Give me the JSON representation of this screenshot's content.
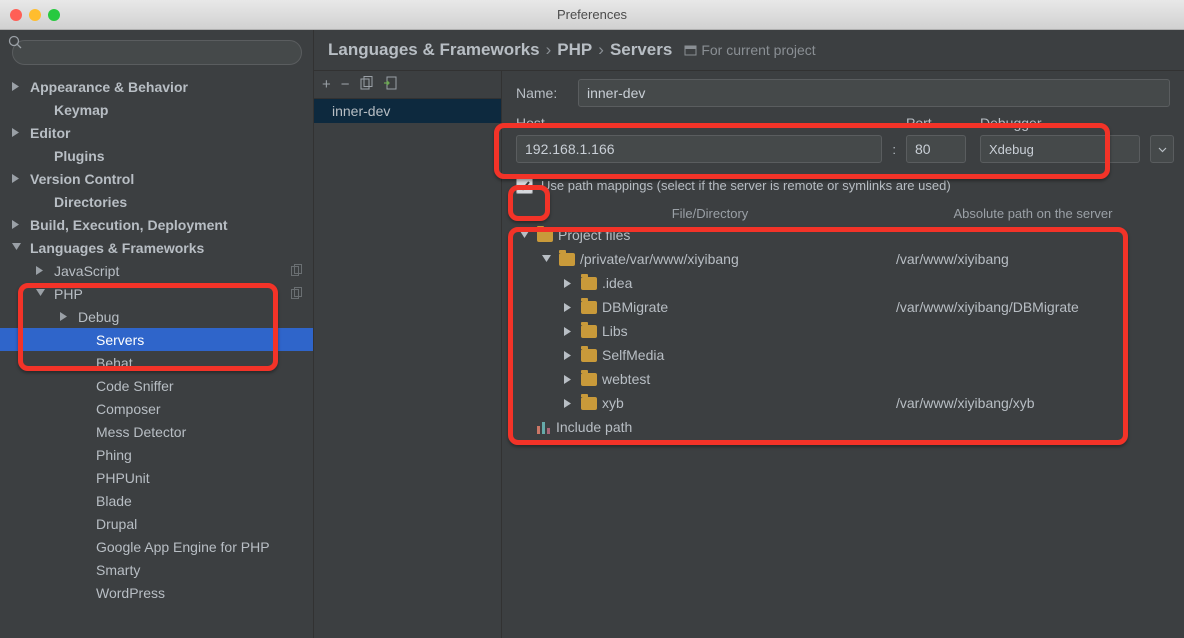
{
  "window": {
    "title": "Preferences"
  },
  "sidebar": {
    "search_placeholder": "",
    "items": [
      {
        "label": "Appearance & Behavior",
        "arrow": "right",
        "bold": true,
        "indent": 0
      },
      {
        "label": "Keymap",
        "arrow": "",
        "bold": true,
        "indent": 1
      },
      {
        "label": "Editor",
        "arrow": "right",
        "bold": true,
        "indent": 0
      },
      {
        "label": "Plugins",
        "arrow": "",
        "bold": true,
        "indent": 1
      },
      {
        "label": "Version Control",
        "arrow": "right",
        "bold": true,
        "indent": 0
      },
      {
        "label": "Directories",
        "arrow": "",
        "bold": true,
        "indent": 1
      },
      {
        "label": "Build, Execution, Deployment",
        "arrow": "right",
        "bold": true,
        "indent": 0
      },
      {
        "label": "Languages & Frameworks",
        "arrow": "down",
        "bold": true,
        "indent": 0
      },
      {
        "label": "JavaScript",
        "arrow": "right",
        "bold": false,
        "indent": 1,
        "copy": true
      },
      {
        "label": "PHP",
        "arrow": "down",
        "bold": false,
        "indent": 1,
        "copy": true
      },
      {
        "label": "Debug",
        "arrow": "right",
        "bold": false,
        "indent": 2
      },
      {
        "label": "Servers",
        "arrow": "",
        "bold": false,
        "indent": 3,
        "selected": true
      },
      {
        "label": "Behat",
        "arrow": "",
        "bold": false,
        "indent": 3
      },
      {
        "label": "Code Sniffer",
        "arrow": "",
        "bold": false,
        "indent": 3
      },
      {
        "label": "Composer",
        "arrow": "",
        "bold": false,
        "indent": 3
      },
      {
        "label": "Mess Detector",
        "arrow": "",
        "bold": false,
        "indent": 3
      },
      {
        "label": "Phing",
        "arrow": "",
        "bold": false,
        "indent": 3
      },
      {
        "label": "PHPUnit",
        "arrow": "",
        "bold": false,
        "indent": 3
      },
      {
        "label": "Blade",
        "arrow": "",
        "bold": false,
        "indent": 3
      },
      {
        "label": "Drupal",
        "arrow": "",
        "bold": false,
        "indent": 3
      },
      {
        "label": "Google App Engine for PHP",
        "arrow": "",
        "bold": false,
        "indent": 3
      },
      {
        "label": "Smarty",
        "arrow": "",
        "bold": false,
        "indent": 3
      },
      {
        "label": "WordPress",
        "arrow": "",
        "bold": false,
        "indent": 3
      }
    ]
  },
  "breadcrumb": {
    "seg0": "Languages & Frameworks",
    "seg1": "PHP",
    "seg2": "Servers",
    "scope": "For current project"
  },
  "servers": {
    "toolbar": {
      "plus": "+",
      "minus": "−",
      "copy": "⎘",
      "import": "⇤"
    },
    "items": [
      "inner-dev"
    ]
  },
  "form": {
    "name_label": "Name:",
    "name_value": "inner-dev",
    "host_label": "Host",
    "host_value": "192.168.1.166",
    "port_label": "Port",
    "port_value": "80",
    "debugger_label": "Debugger",
    "debugger_value": "Xdebug",
    "mappings_label": "Use path mappings (select if the server is remote or symlinks are used)",
    "mappings_checked": true,
    "map_header1": "File/Directory",
    "map_header2": "Absolute path on the server",
    "tree": [
      {
        "indent": 0,
        "arrow": "down",
        "icon": "folder",
        "label": "Project files",
        "remote": ""
      },
      {
        "indent": 1,
        "arrow": "down",
        "icon": "folder",
        "label": "/private/var/www/xiyibang",
        "remote": "/var/www/xiyibang"
      },
      {
        "indent": 2,
        "arrow": "right",
        "icon": "folder",
        "label": ".idea",
        "remote": ""
      },
      {
        "indent": 2,
        "arrow": "right",
        "icon": "folder",
        "label": "DBMigrate",
        "remote": "/var/www/xiyibang/DBMigrate"
      },
      {
        "indent": 2,
        "arrow": "right",
        "icon": "folder",
        "label": "Libs",
        "remote": ""
      },
      {
        "indent": 2,
        "arrow": "right",
        "icon": "folder",
        "label": "SelfMedia",
        "remote": ""
      },
      {
        "indent": 2,
        "arrow": "right",
        "icon": "folder",
        "label": "webtest",
        "remote": ""
      },
      {
        "indent": 2,
        "arrow": "right",
        "icon": "folder",
        "label": "xyb",
        "remote": "/var/www/xiyibang/xyb"
      },
      {
        "indent": 0,
        "arrow": "",
        "icon": "lib",
        "label": "Include path",
        "remote": ""
      }
    ]
  }
}
